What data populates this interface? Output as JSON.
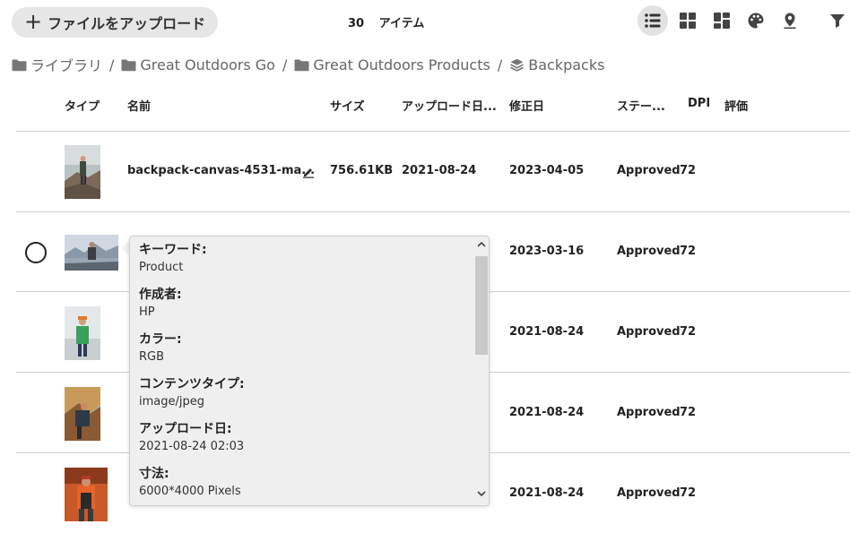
{
  "toolbar": {
    "upload_label": "ファイルをアップロード",
    "upload_plus": "+",
    "item_count_number": "30",
    "item_count_label": "アイテム"
  },
  "breadcrumb": {
    "items": [
      {
        "label": "ライブラリ",
        "icon": "folder-icon"
      },
      {
        "label": "Great Outdoors Go",
        "icon": "folder-icon"
      },
      {
        "label": "Great Outdoors Products",
        "icon": "folder-icon"
      },
      {
        "label": "Backpacks",
        "icon": "layers-icon"
      }
    ],
    "separator": "/"
  },
  "table": {
    "columns": [
      "タイプ",
      "名前",
      "サイズ",
      "アップロード日...",
      "修正日",
      "ステー...",
      "DPI",
      "評価"
    ],
    "rows": [
      {
        "name": "backpack-canvas-4531-ma...",
        "size": "756.61KB",
        "uploaded": "2021-08-24",
        "modified": "2023-04-05",
        "status": "Approved",
        "dpi": "72"
      },
      {
        "modified": "2023-03-16",
        "status": "Approved",
        "dpi": "72"
      },
      {
        "modified": "2021-08-24",
        "status": "Approved",
        "dpi": "72"
      },
      {
        "modified": "2021-08-24",
        "status": "Approved",
        "dpi": "72"
      },
      {
        "modified": "2021-08-24",
        "status": "Approved",
        "dpi": "72"
      }
    ]
  },
  "popup": {
    "items": [
      {
        "label": "キーワード:",
        "value": "Product"
      },
      {
        "label": "作成者:",
        "value": "HP"
      },
      {
        "label": "カラー:",
        "value": "RGB"
      },
      {
        "label": "コンテンツタイプ:",
        "value": "image/jpeg"
      },
      {
        "label": "アップロード日:",
        "value": "2021-08-24 02:03"
      },
      {
        "label": "寸法:",
        "value": "6000*4000 Pixels"
      }
    ]
  },
  "colors": {
    "upload_bg": "#e6e6e6",
    "popup_bg": "#efefef",
    "active_view_bg": "#e2e2e2"
  }
}
